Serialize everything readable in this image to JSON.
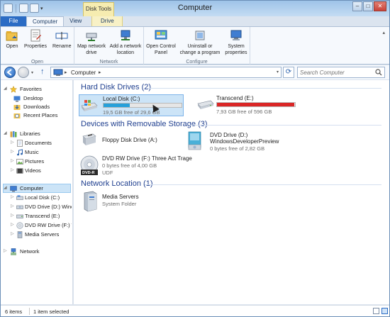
{
  "window": {
    "title": "Computer"
  },
  "ribbon": {
    "contextual_group": "Disk Tools",
    "tabs": [
      "File",
      "Computer",
      "View",
      "Drive"
    ],
    "groups": [
      {
        "label": "Open",
        "buttons": [
          "Open",
          "Properties",
          "Rename"
        ]
      },
      {
        "label": "Network",
        "buttons": [
          "Map network drive",
          "Add a network location"
        ]
      },
      {
        "label": "Configure",
        "buttons": [
          "Open Control Panel",
          "Uninstall or change a program",
          "System properties"
        ]
      }
    ]
  },
  "address": {
    "breadcrumb": "Computer",
    "search_placeholder": "Search Computer"
  },
  "navpane": {
    "favorites": {
      "label": "Favorites",
      "items": [
        "Desktop",
        "Downloads",
        "Recent Places"
      ]
    },
    "libraries": {
      "label": "Libraries",
      "items": [
        "Documents",
        "Music",
        "Pictures",
        "Videos"
      ]
    },
    "computer": {
      "label": "Computer",
      "items": [
        "Local Disk (C:)",
        "DVD Drive (D:) Wind",
        "Transcend (E:)",
        "DVD RW Drive (F:) Tl",
        "Media Servers"
      ]
    },
    "network": {
      "label": "Network"
    }
  },
  "content": {
    "groups": [
      {
        "header": "Hard Disk Drives (2)",
        "items": [
          {
            "name": "Local Disk (C:)",
            "sub": "19,5 GB free of 29,6 GB",
            "used_fraction": 0.34,
            "bar_color": "#26a0da",
            "selected": true
          },
          {
            "name": "Transcend (E:)",
            "sub": "7,93 GB free of 596 GB",
            "used_fraction": 0.99,
            "bar_color": "#da2626",
            "selected": false
          }
        ]
      },
      {
        "header": "Devices with Removable Storage (3)",
        "items": [
          {
            "name": "Floppy Disk Drive (A:)"
          },
          {
            "name": "DVD Drive (D:)",
            "name2": "WindowsDeveloperPreview",
            "sub": "0 bytes free of 2,82 GB"
          },
          {
            "name": "DVD RW Drive (F:) Three Act Trage",
            "sub": "0 bytes free of 4,00 GB",
            "sub2": "UDF",
            "badge": "DVD-R"
          }
        ]
      },
      {
        "header": "Network Location (1)",
        "items": [
          {
            "name": "Media Servers",
            "sub": "System Folder"
          }
        ]
      }
    ]
  },
  "status": {
    "count": "6 items",
    "selected": "1 item selected"
  }
}
